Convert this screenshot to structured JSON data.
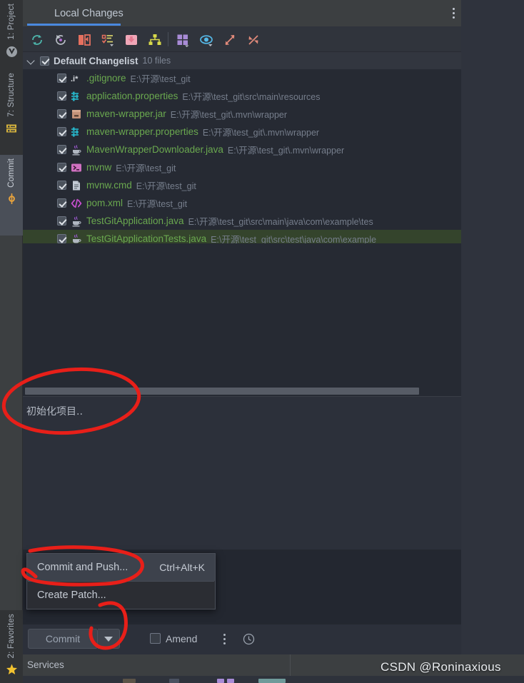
{
  "rail": {
    "items": [
      {
        "label": "1: Project",
        "icon": "project-icon"
      },
      {
        "label": "7: Structure",
        "icon": "structure-icon"
      },
      {
        "label": "Commit",
        "icon": "commit-icon"
      },
      {
        "label": "2: Favorites",
        "icon": "star-icon"
      }
    ]
  },
  "window": {
    "tab_label": "Local Changes",
    "more_icon": "kebab-menu-icon",
    "minimize_icon": "minimize-icon"
  },
  "toolbar": {
    "buttons": [
      {
        "name": "refresh-icon",
        "title": "Refresh"
      },
      {
        "name": "rollback-icon",
        "title": "Rollback"
      },
      {
        "name": "show-diff-icon",
        "title": "Show Diff"
      },
      {
        "name": "new-changelist-icon",
        "title": "New Changelist"
      },
      {
        "name": "move-to-changelist-icon",
        "title": "Move to Another Changelist"
      },
      {
        "name": "group-by-icon",
        "title": "Group By"
      },
      {
        "name": "show-as-tree-icon",
        "title": "Show as Tree"
      },
      {
        "name": "preview-diff-icon",
        "title": "Preview Diff"
      },
      {
        "name": "expand-all-icon",
        "title": "Expand All"
      },
      {
        "name": "collapse-all-icon",
        "title": "Collapse All"
      }
    ]
  },
  "changelist": {
    "checked": true,
    "title": "Default Changelist",
    "count": "10 files"
  },
  "files": [
    {
      "checked": true,
      "icon": "gitignore-icon",
      "name": ".gitignore",
      "path": "E:\\开源\\test_git"
    },
    {
      "checked": true,
      "icon": "properties-icon",
      "name": "application.properties",
      "path": "E:\\开源\\test_git\\src\\main\\resources"
    },
    {
      "checked": true,
      "icon": "jar-icon",
      "name": "maven-wrapper.jar",
      "path": "E:\\开源\\test_git\\.mvn\\wrapper"
    },
    {
      "checked": true,
      "icon": "properties-icon",
      "name": "maven-wrapper.properties",
      "path": "E:\\开源\\test_git\\.mvn\\wrapper"
    },
    {
      "checked": true,
      "icon": "java-icon",
      "name": "MavenWrapperDownloader.java",
      "path": "E:\\开源\\test_git\\.mvn\\wrapper"
    },
    {
      "checked": true,
      "icon": "shell-icon",
      "name": "mvnw",
      "path": "E:\\开源\\test_git"
    },
    {
      "checked": true,
      "icon": "file-icon",
      "name": "mvnw.cmd",
      "path": "E:\\开源\\test_git"
    },
    {
      "checked": true,
      "icon": "xml-icon",
      "name": "pom.xml",
      "path": "E:\\开源\\test_git"
    },
    {
      "checked": true,
      "icon": "java-icon",
      "name": "TestGitApplication.java",
      "path": "E:\\开源\\test_git\\src\\main\\java\\com\\example\\tes"
    },
    {
      "checked": true,
      "icon": "java-icon",
      "name": "TestGitApplicationTests.java",
      "path": "E:\\开源\\test_git\\src\\test\\java\\com\\example",
      "selected": true
    }
  ],
  "commit_message": {
    "value": "初始化项目.."
  },
  "popup": {
    "items": [
      {
        "label": "Commit and Push...",
        "shortcut": "Ctrl+Alt+K",
        "highlighted": true
      },
      {
        "label": "Create Patch...",
        "shortcut": ""
      }
    ]
  },
  "commit_bar": {
    "commit_label": "Commit",
    "dropdown_icon": "chevron-down-icon",
    "amend_label": "Amend",
    "amend_checked": false,
    "more_icon": "kebab-menu-icon",
    "history_icon": "clock-icon"
  },
  "status_bar": {
    "services_label": "Services"
  },
  "watermark": {
    "text": "CSDN @Roninaxious"
  },
  "colors": {
    "accent_blue": "#4a88df",
    "file_green": "#6aa84f",
    "selection_green": "#34442c",
    "annotation_red": "#e81f19",
    "panel_bg": "#262a33",
    "toolbar_bg": "#30343c",
    "rail_bg": "#3c3f41"
  }
}
